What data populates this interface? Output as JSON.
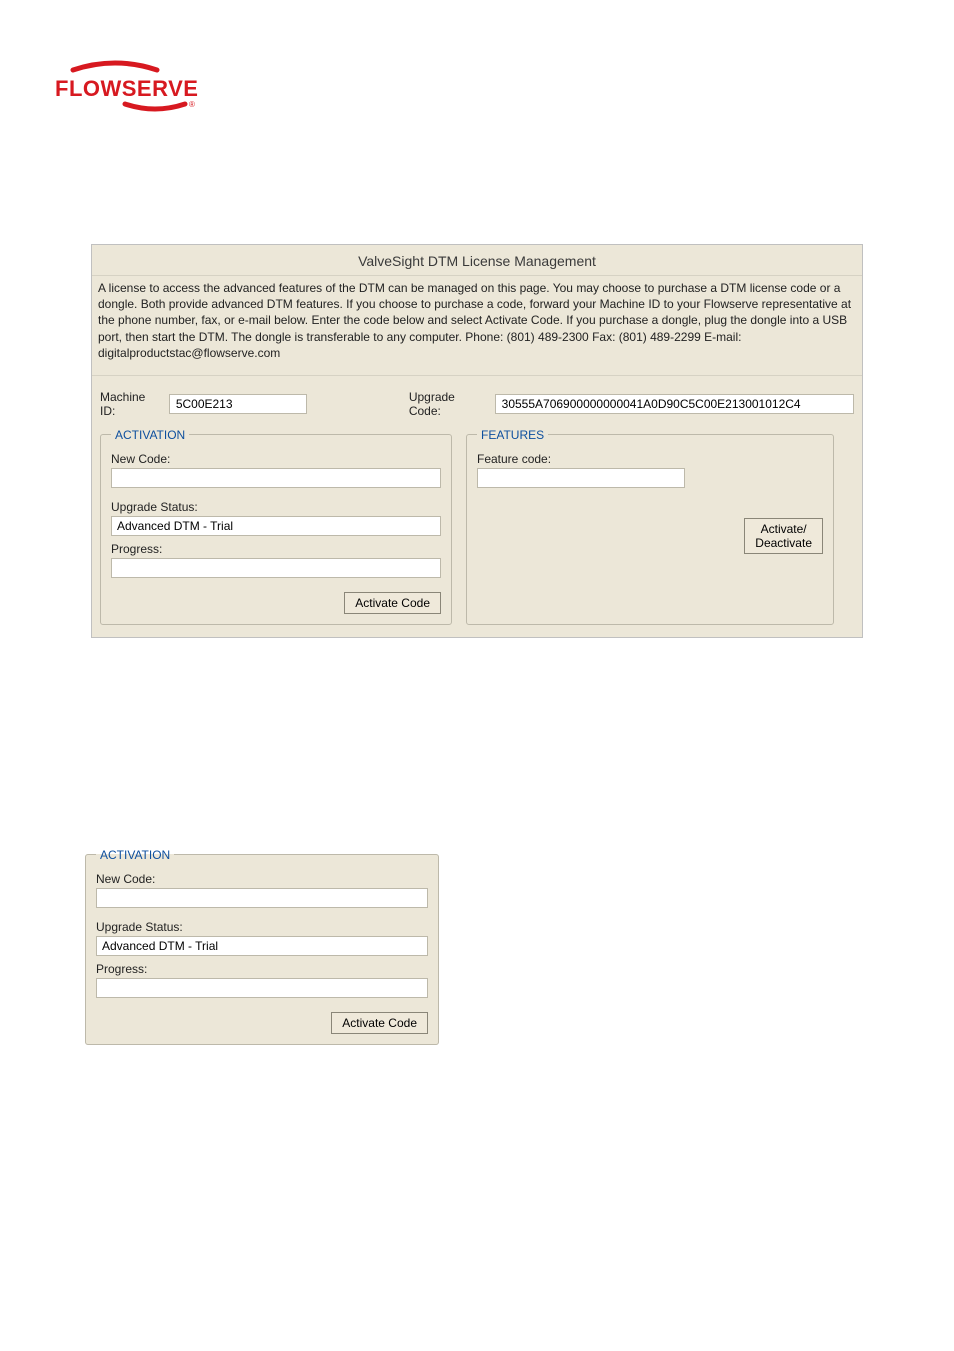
{
  "brand": "FLOWSERVE",
  "dialogTitle": "ValveSight DTM License Management",
  "description": "A license to access the advanced features of the DTM can be managed on this page.  You may choose to purchase a DTM license code or a dongle.  Both provide advanced DTM features.  If you choose to purchase a code, forward your Machine ID to your Flowserve representative at the phone number, fax, or e-mail below.   Enter the code below and select Activate Code.  If you purchase a dongle, plug the dongle into a USB port, then start the DTM.  The dongle is transferable to any computer.  Phone: (801) 489-2300 Fax: (801) 489-2299  E-mail: digitalproductstac@flowserve.com",
  "machineIdLabel": "Machine ID:",
  "machineId": "5C00E213",
  "upgradeCodeLabel": "Upgrade Code:",
  "upgradeCode": "30555A706900000000041A0D90C5C00E213001012C4",
  "activation": {
    "legend": "ACTIVATION",
    "newCodeLabel": "New Code:",
    "newCode": "",
    "upgradeStatusLabel": "Upgrade Status:",
    "upgradeStatus": "Advanced DTM - Trial",
    "progressLabel": "Progress:",
    "activateBtn": "Activate Code"
  },
  "features": {
    "legend": "FEATURES",
    "featureCodeLabel": "Feature code:",
    "featureCode": "",
    "activateBtn": "Activate/\nDeactivate"
  }
}
